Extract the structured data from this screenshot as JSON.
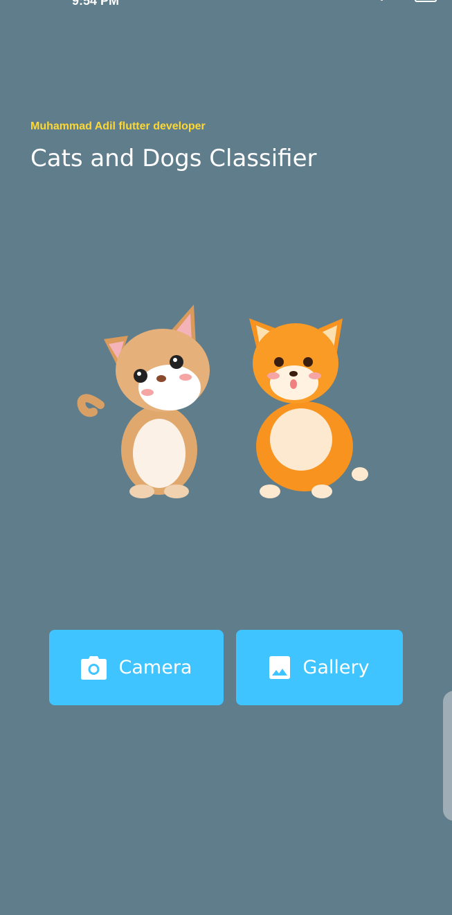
{
  "status_bar": {
    "time": "9:54 PM"
  },
  "header": {
    "subtitle": "Muhammad Adil flutter developer",
    "title": "Cats and Dogs Classifier"
  },
  "illustration": {
    "subjects": [
      "cat-icon",
      "dog-icon"
    ]
  },
  "actions": {
    "camera": {
      "label": "Camera",
      "icon": "camera-icon"
    },
    "gallery": {
      "label": "Gallery",
      "icon": "image-icon"
    }
  },
  "colors": {
    "background": "#607d8b",
    "accent": "#40c4ff",
    "subtitle": "#fdd835"
  }
}
